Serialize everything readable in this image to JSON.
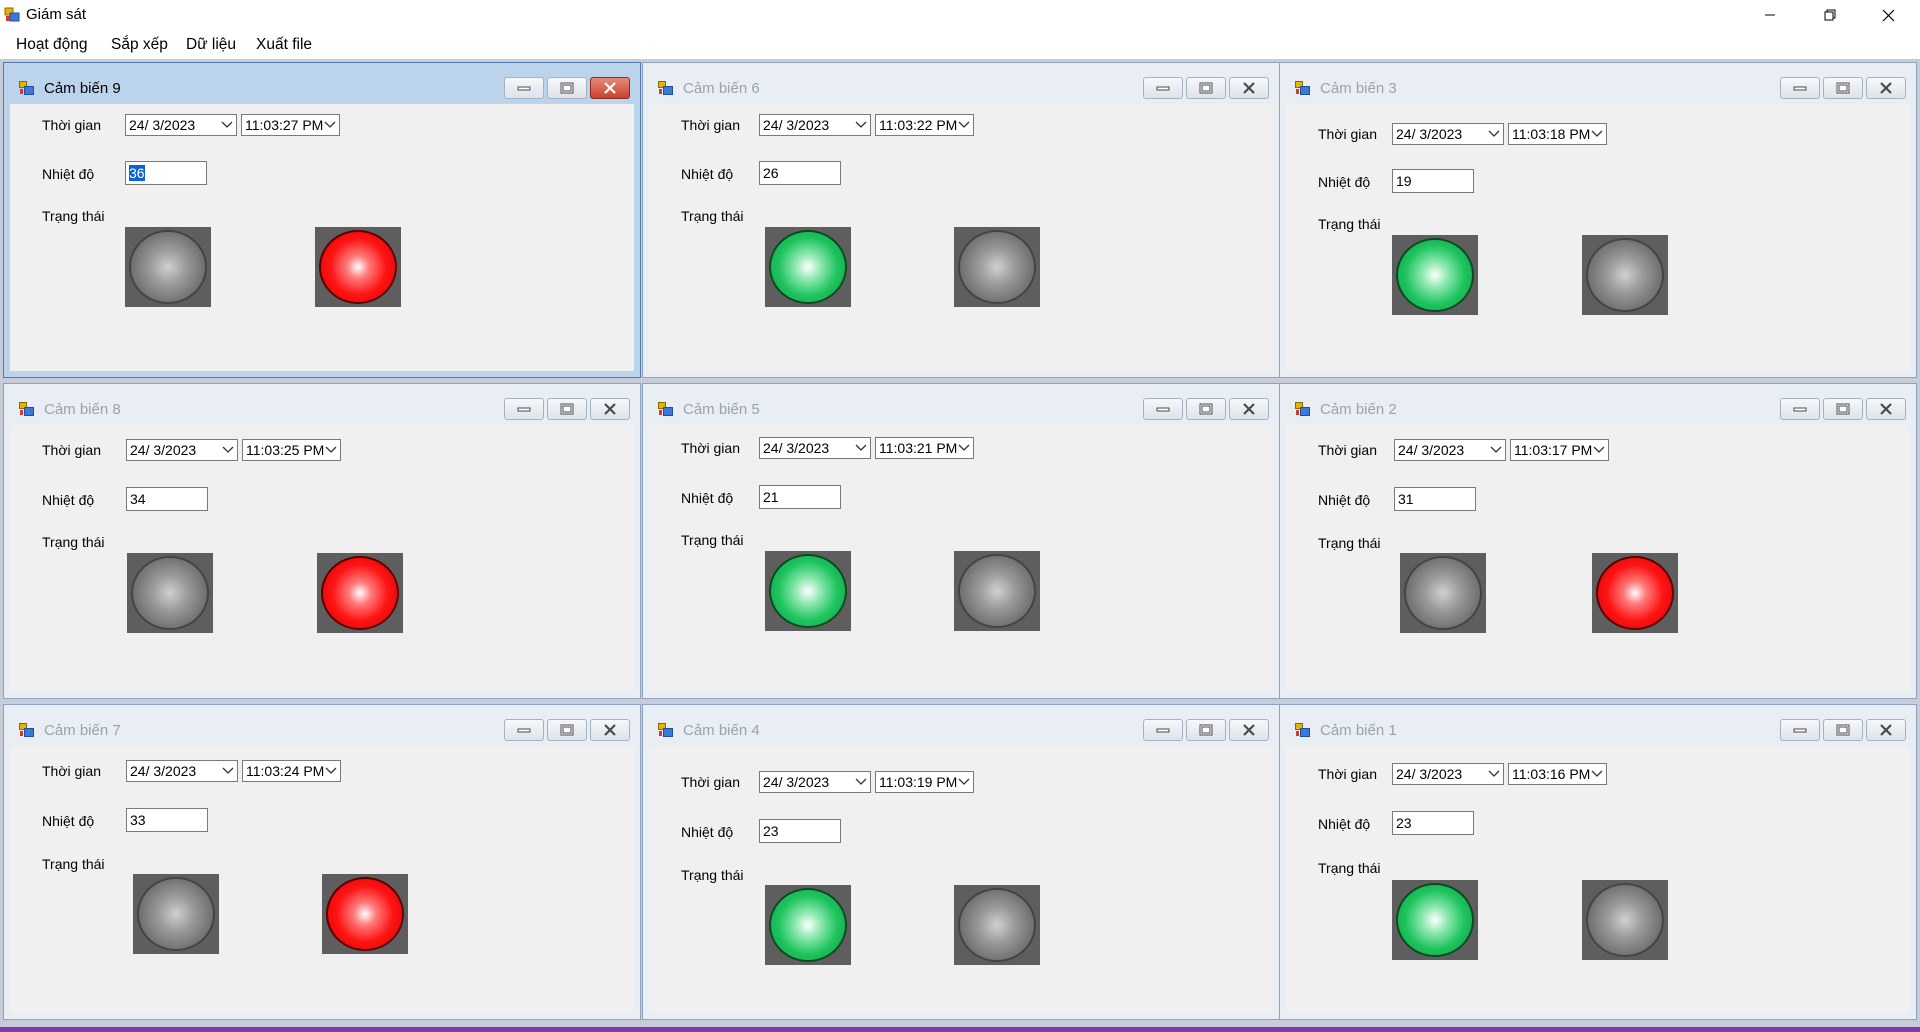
{
  "window": {
    "title": "Giám sát",
    "app_icon": "winforms-app-icon"
  },
  "window_controls": {
    "minimize_icon": "minimize-icon",
    "restore_icon": "restore-icon",
    "close_icon": "close-icon"
  },
  "menu": [
    "Hoạt động",
    "Sắp xếp",
    "Dữ liệu",
    "Xuất file"
  ],
  "labels": {
    "time": "Thời gian",
    "temperature": "Nhiệt độ",
    "status": "Trạng thái"
  },
  "colors": {
    "lamp_red": "#ff1414",
    "lamp_green": "#1ec45e",
    "lamp_off": "#8a8a8a",
    "mdi_background": "#c6cdd9"
  },
  "sensors": [
    {
      "title": "Cảm biến 9",
      "active": true,
      "date": "24/  3/2023",
      "time": "11:03:27 PM",
      "temperature": "36",
      "temperature_selected": true,
      "lamp1": "off",
      "lamp2": "red"
    },
    {
      "title": "Cảm biến 6",
      "active": false,
      "date": "24/  3/2023",
      "time": "11:03:22 PM",
      "temperature": "26",
      "lamp1": "green",
      "lamp2": "off"
    },
    {
      "title": "Cảm biến 3",
      "active": false,
      "date": "24/  3/2023",
      "time": "11:03:18 PM",
      "temperature": "19",
      "lamp1": "green",
      "lamp2": "off"
    },
    {
      "title": "Cảm biến 8",
      "active": false,
      "date": "24/  3/2023",
      "time": "11:03:25 PM",
      "temperature": "34",
      "lamp1": "off",
      "lamp2": "red"
    },
    {
      "title": "Cảm biến 5",
      "active": false,
      "date": "24/  3/2023",
      "time": "11:03:21 PM",
      "temperature": "21",
      "lamp1": "green",
      "lamp2": "off"
    },
    {
      "title": "Cảm biến 2",
      "active": false,
      "date": "24/  3/2023",
      "time": "11:03:17 PM",
      "temperature": "31",
      "lamp1": "off",
      "lamp2": "red"
    },
    {
      "title": "Cảm biến 7",
      "active": false,
      "date": "24/  3/2023",
      "time": "11:03:24 PM",
      "temperature": "33",
      "lamp1": "off",
      "lamp2": "red"
    },
    {
      "title": "Cảm biến 4",
      "active": false,
      "date": "24/  3/2023",
      "time": "11:03:19 PM",
      "temperature": "23",
      "lamp1": "green",
      "lamp2": "off"
    },
    {
      "title": "Cảm biến 1",
      "active": false,
      "date": "24/  3/2023",
      "time": "11:03:16 PM",
      "temperature": "23",
      "lamp1": "green",
      "lamp2": "off"
    }
  ]
}
